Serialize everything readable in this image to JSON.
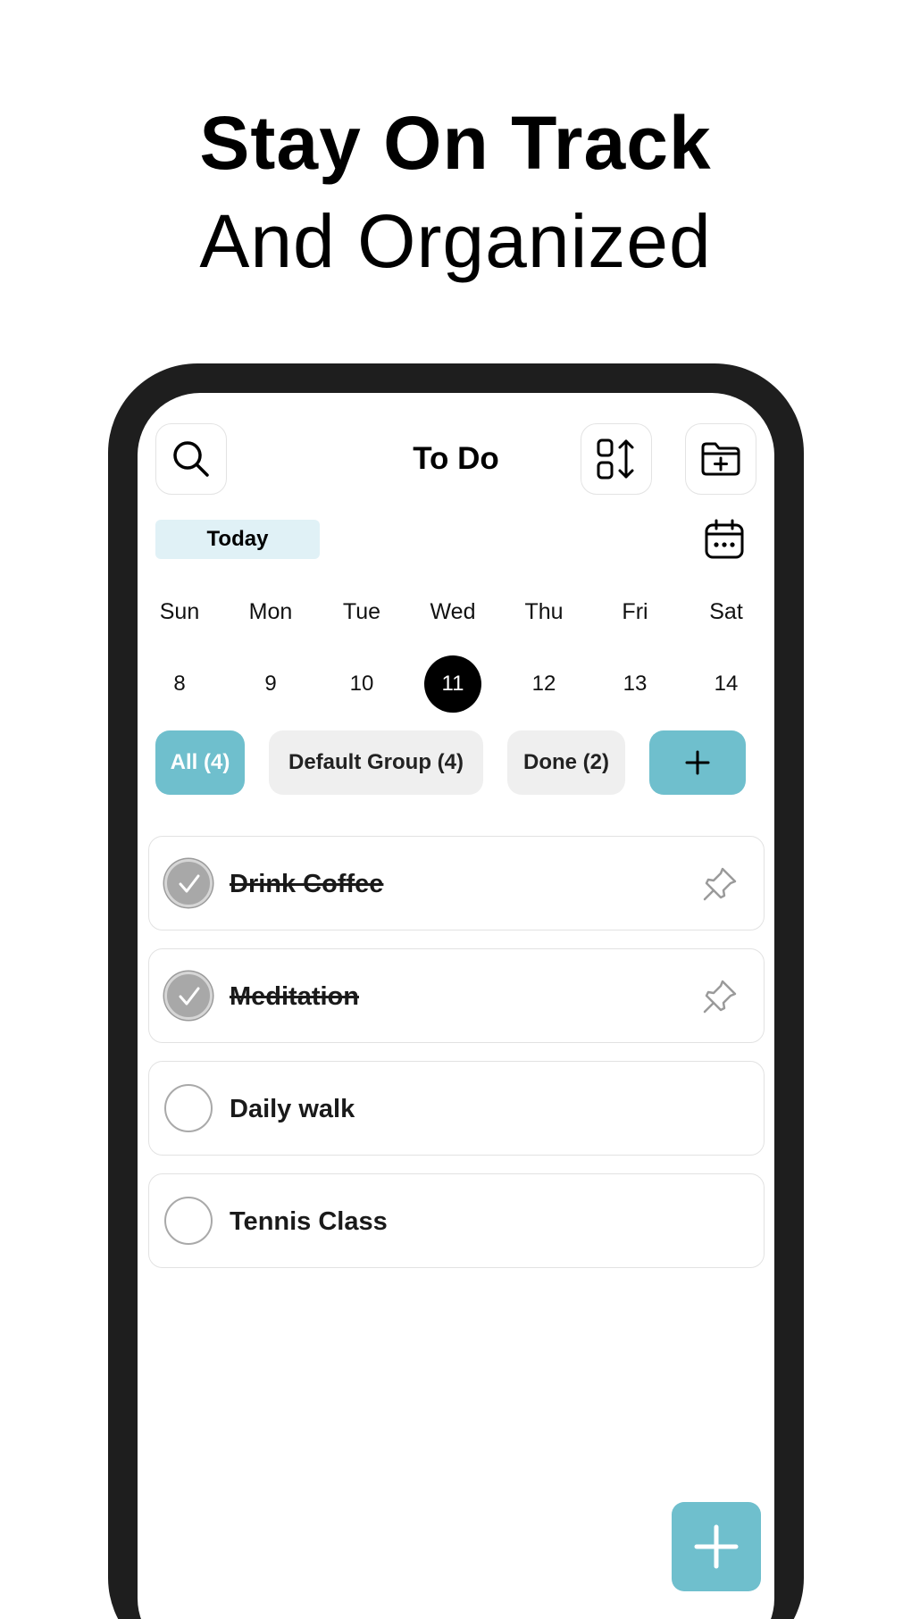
{
  "headline": {
    "line1": "Stay On Track",
    "line2": "And Organized"
  },
  "app": {
    "title": "To Do",
    "today_label": "Today",
    "week": [
      {
        "day": "Sun",
        "date": "8",
        "selected": false
      },
      {
        "day": "Mon",
        "date": "9",
        "selected": false
      },
      {
        "day": "Tue",
        "date": "10",
        "selected": false
      },
      {
        "day": "Wed",
        "date": "11",
        "selected": true
      },
      {
        "day": "Thu",
        "date": "12",
        "selected": false
      },
      {
        "day": "Fri",
        "date": "13",
        "selected": false
      },
      {
        "day": "Sat",
        "date": "14",
        "selected": false
      }
    ],
    "filters": {
      "all": "All (4)",
      "default_group": "Default Group (4)",
      "done": "Done (2)",
      "add": "+"
    },
    "tasks": [
      {
        "label": "Drink Coffee",
        "done": true,
        "pinned": true
      },
      {
        "label": "Meditation",
        "done": true,
        "pinned": true
      },
      {
        "label": "Daily walk",
        "done": false,
        "pinned": false
      },
      {
        "label": "Tennis Class",
        "done": false,
        "pinned": false
      }
    ],
    "icons": {
      "search": "search-icon",
      "sort": "sort-icon",
      "add_folder": "folder-add-icon",
      "calendar": "calendar-icon",
      "pin": "pin-icon",
      "add": "plus-icon"
    },
    "colors": {
      "accent": "#6fbfcd",
      "today_bg": "#e0f1f6",
      "frame": "#1e1e1e"
    }
  }
}
